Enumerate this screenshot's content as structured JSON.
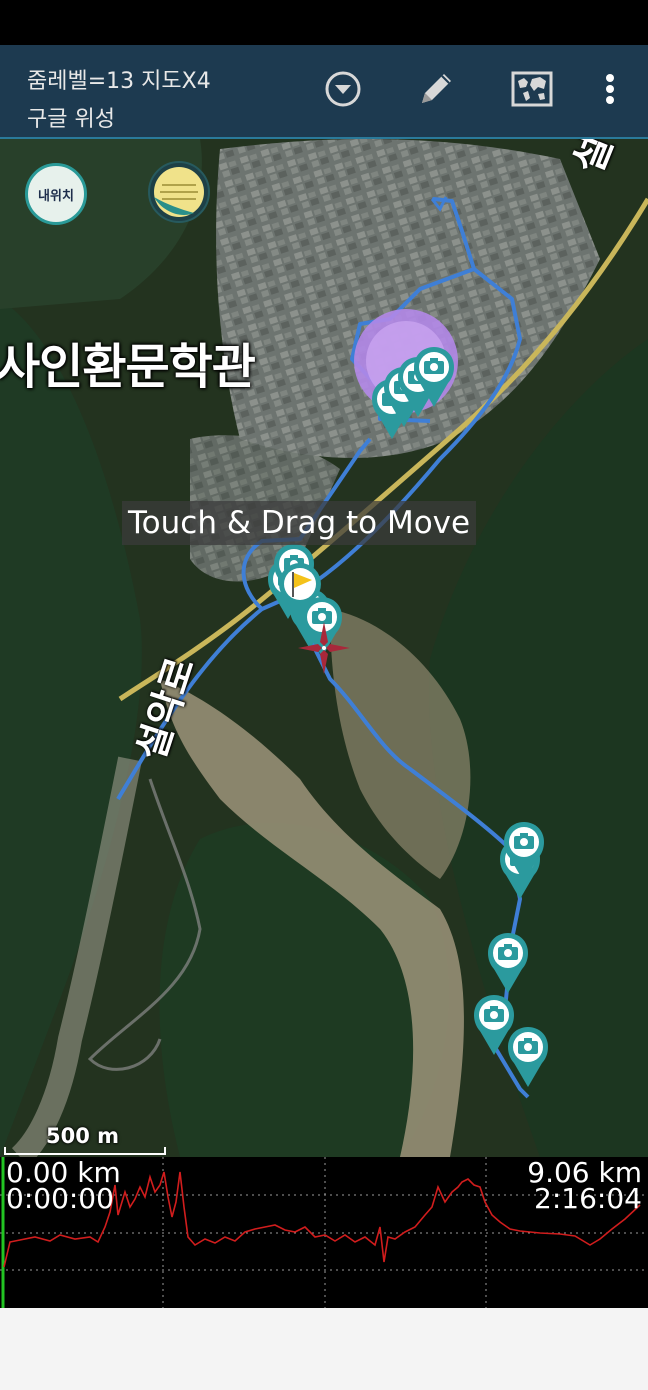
{
  "header": {
    "zoom_text": "줌레벨=13 지도X4",
    "map_source": "구글 위성",
    "icons": [
      "dropdown-circle-icon",
      "pencil-icon",
      "map-icon",
      "more-vert-icon"
    ]
  },
  "map": {
    "my_location_label": "내위치",
    "place_label": "사인환문학관",
    "road_label_1": "설악로",
    "road_label_2": "설악로",
    "drag_hint": "Touch & Drag to Move",
    "scale_label": "500 m",
    "track_color": "#3f7fd6",
    "marker_color": "#2b9a9e",
    "flag_color": "#f4c21a",
    "crosshair_color": "#a8283a"
  },
  "profile": {
    "dist_start": "0.00 km",
    "time_start": "0:00:00",
    "dist_end": "9.06 km",
    "time_end": "2:16:04",
    "line_color": "#d11d1d"
  }
}
